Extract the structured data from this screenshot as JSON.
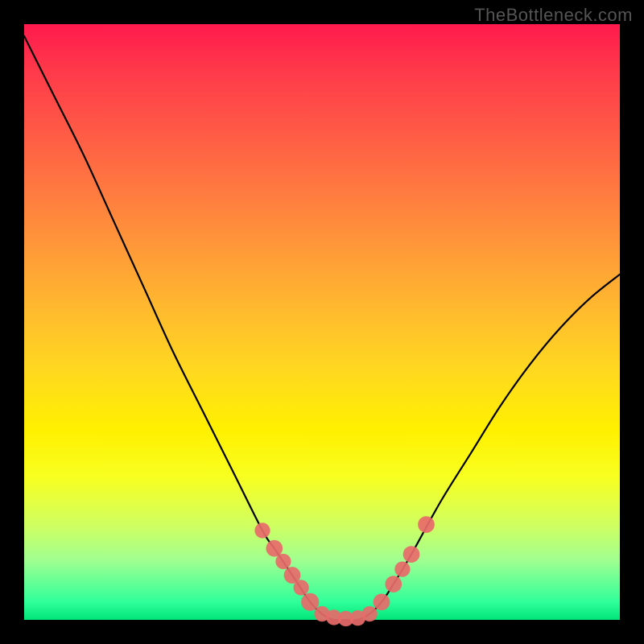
{
  "watermark": "TheBottleneck.com",
  "chart_data": {
    "type": "line",
    "title": "",
    "xlabel": "",
    "ylabel": "",
    "xlim": [
      0,
      100
    ],
    "ylim": [
      0,
      100
    ],
    "series": [
      {
        "name": "bottleneck-curve",
        "x": [
          0,
          5,
          10,
          15,
          20,
          25,
          30,
          35,
          40,
          42,
          44,
          46,
          48,
          50,
          52,
          54,
          56,
          58,
          60,
          62,
          65,
          70,
          75,
          80,
          85,
          90,
          95,
          100
        ],
        "y": [
          98,
          88,
          78,
          67,
          56,
          45,
          35,
          25,
          15,
          12,
          9,
          6,
          3,
          1,
          0,
          0,
          0,
          1,
          3,
          6,
          11,
          20,
          28,
          36,
          43,
          49,
          54,
          58
        ]
      }
    ],
    "markers": {
      "name": "highlighted-points",
      "points": [
        {
          "x": 40.0,
          "y": 15.0,
          "r": 1.3
        },
        {
          "x": 42.0,
          "y": 12.0,
          "r": 1.4
        },
        {
          "x": 43.5,
          "y": 9.8,
          "r": 1.3
        },
        {
          "x": 45.0,
          "y": 7.5,
          "r": 1.4
        },
        {
          "x": 46.5,
          "y": 5.4,
          "r": 1.3
        },
        {
          "x": 48.0,
          "y": 3.0,
          "r": 1.5
        },
        {
          "x": 50.0,
          "y": 1.0,
          "r": 1.3
        },
        {
          "x": 52.0,
          "y": 0.4,
          "r": 1.3
        },
        {
          "x": 54.0,
          "y": 0.2,
          "r": 1.3
        },
        {
          "x": 56.0,
          "y": 0.3,
          "r": 1.3
        },
        {
          "x": 58.0,
          "y": 1.0,
          "r": 1.3
        },
        {
          "x": 60.0,
          "y": 3.0,
          "r": 1.4
        },
        {
          "x": 62.0,
          "y": 6.0,
          "r": 1.4
        },
        {
          "x": 63.5,
          "y": 8.5,
          "r": 1.3
        },
        {
          "x": 65.0,
          "y": 11.0,
          "r": 1.4
        },
        {
          "x": 67.5,
          "y": 16.0,
          "r": 1.4
        }
      ]
    },
    "background_gradient": {
      "top": "#ff1a4d",
      "mid": "#fff000",
      "bottom": "#00e57a"
    }
  }
}
